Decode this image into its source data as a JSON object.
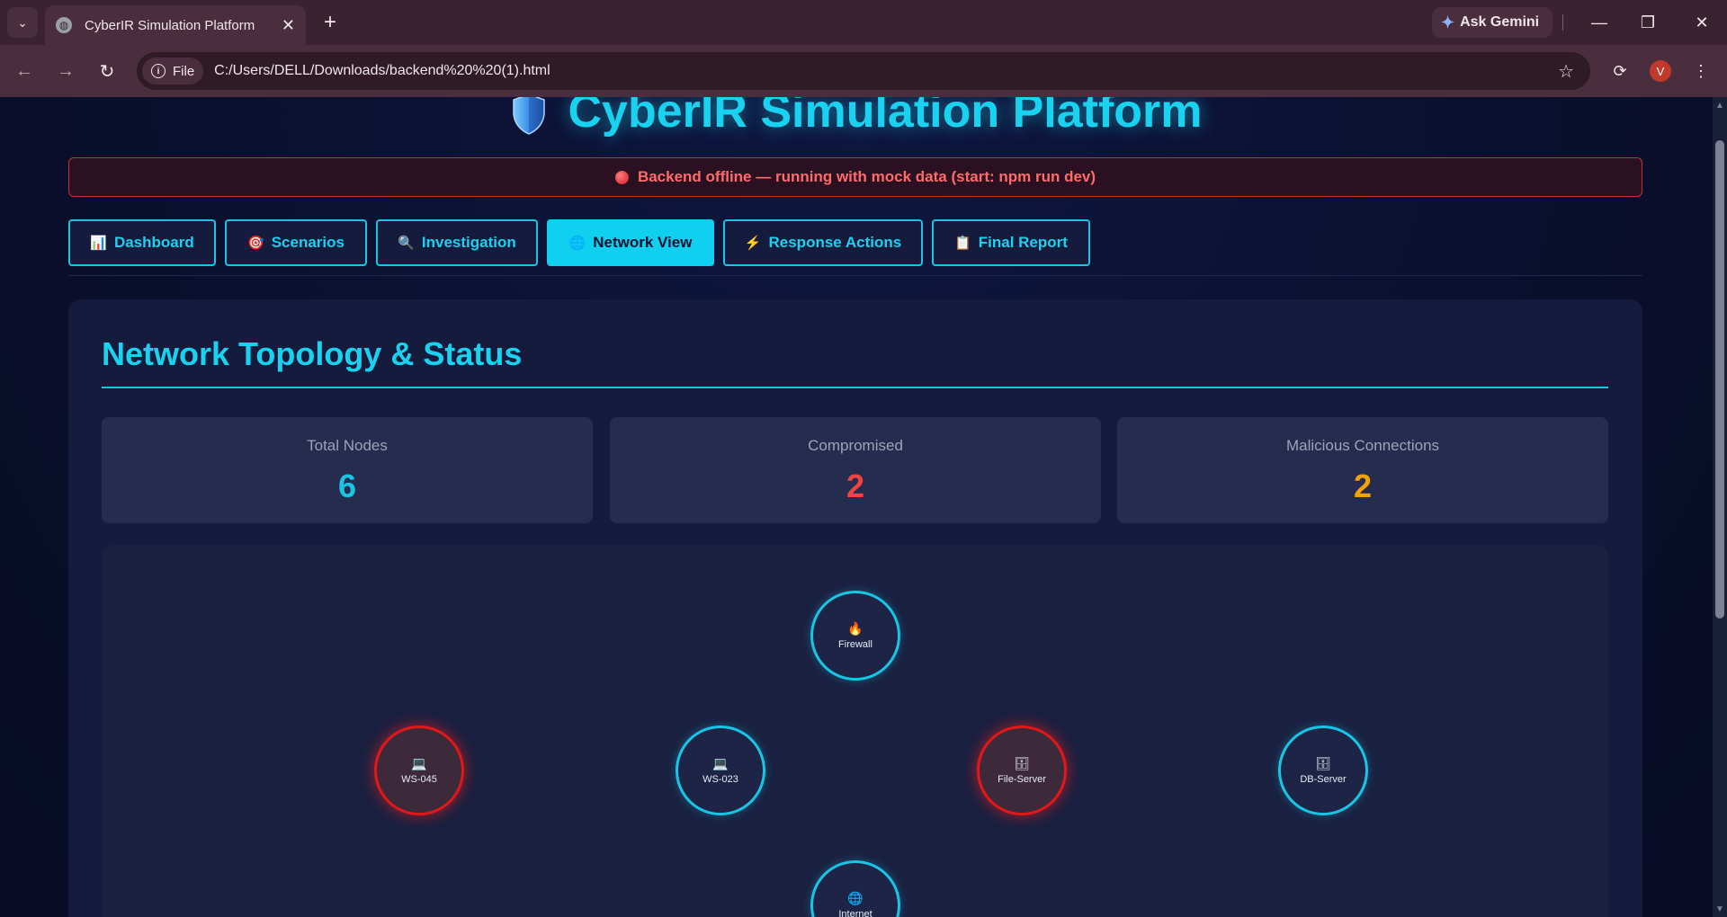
{
  "browser": {
    "tab_title": "CyberIR Simulation Platform",
    "tab_close": "✕",
    "new_tab": "+",
    "gemini_label": "Ask Gemini",
    "file_chip": "File",
    "url": "C:/Users/DELL/Downloads/backend%20%20(1).html",
    "profile_initial": "V"
  },
  "app": {
    "title": "CyberIR Simulation Platform",
    "alert": "Backend offline — running with mock data (start: npm run dev)",
    "tabs": [
      {
        "label": "Dashboard",
        "icon": "📊"
      },
      {
        "label": "Scenarios",
        "icon": "🎯"
      },
      {
        "label": "Investigation",
        "icon": "🔍"
      },
      {
        "label": "Network View",
        "icon": "🌐"
      },
      {
        "label": "Response Actions",
        "icon": "⚡"
      },
      {
        "label": "Final Report",
        "icon": "📋"
      }
    ],
    "active_tab": "Network View"
  },
  "network": {
    "title": "Network Topology & Status",
    "stats": [
      {
        "label": "Total Nodes",
        "value": "6",
        "color": "#19c4e4"
      },
      {
        "label": "Compromised",
        "value": "2",
        "color": "#ef4444"
      },
      {
        "label": "Malicious Connections",
        "value": "2",
        "color": "#f5a20a"
      }
    ],
    "nodes": [
      {
        "name": "Firewall",
        "icon": "🔥",
        "status": "normal"
      },
      {
        "name": "WS-045",
        "icon": "💻",
        "status": "compromised"
      },
      {
        "name": "WS-023",
        "icon": "💻",
        "status": "normal"
      },
      {
        "name": "File-Server",
        "icon": "🗄",
        "status": "compromised"
      },
      {
        "name": "DB-Server",
        "icon": "🗄",
        "status": "normal"
      },
      {
        "name": "Internet",
        "icon": "🌐",
        "status": "normal"
      }
    ]
  },
  "colors": {
    "accent": "#19d2f0",
    "alert_red": "#ff6b6b",
    "compromised": "#e01818",
    "warning": "#f5a20a"
  }
}
